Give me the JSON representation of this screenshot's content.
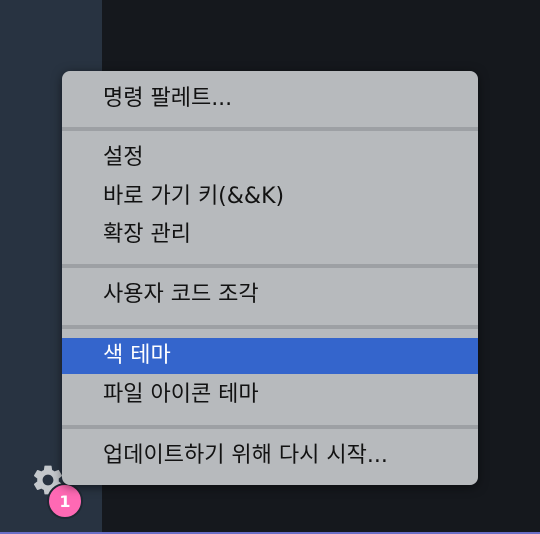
{
  "menu": {
    "items": [
      {
        "label": "명령 팔레트..."
      },
      {
        "label": "설정"
      },
      {
        "label": "바로 가기 키(&&K)"
      },
      {
        "label": "확장 관리"
      },
      {
        "label": "사용자 코드 조각"
      },
      {
        "label": "색 테마",
        "selected": true
      },
      {
        "label": "파일 아이콘 테마"
      },
      {
        "label": "업데이트하기 위해 다시 시작..."
      }
    ]
  },
  "activity_bar": {
    "manage_icon": "gear-icon",
    "badge_count": "1"
  },
  "colors": {
    "menu_bg": "#b7babd",
    "selected_bg": "#3465cc",
    "badge": "#ff69b4",
    "activity_bar": "#283341"
  }
}
